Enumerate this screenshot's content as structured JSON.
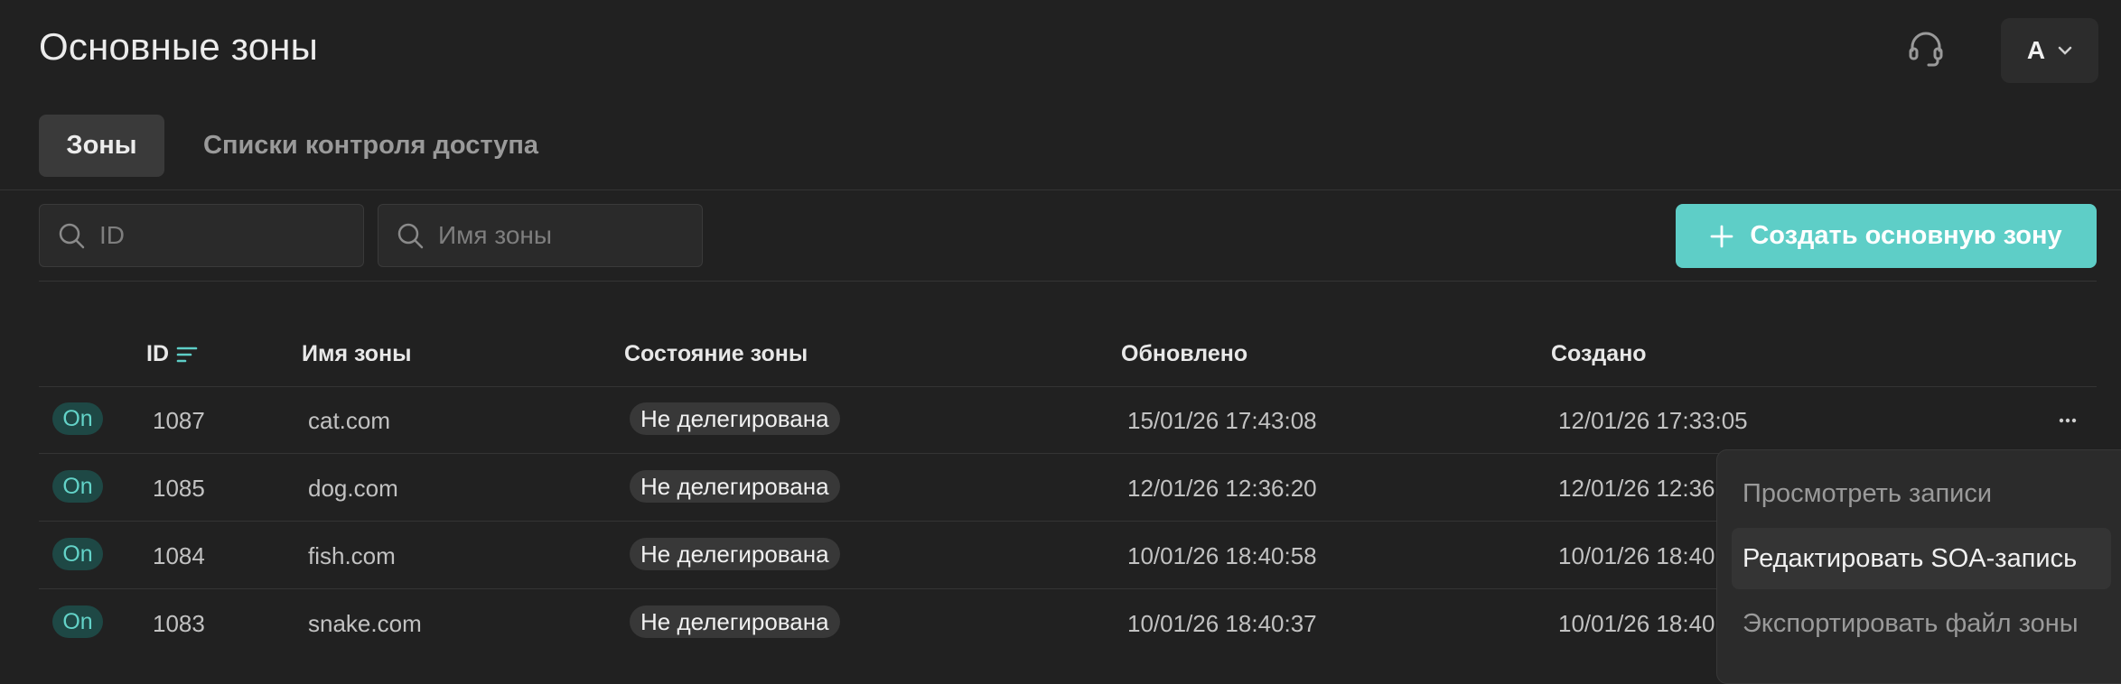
{
  "header": {
    "title": "Основные зоны",
    "user_initial": "A"
  },
  "tabs": [
    {
      "label": "Зоны",
      "active": true
    },
    {
      "label": "Списки контроля доступа",
      "active": false
    }
  ],
  "filters": {
    "id_placeholder": "ID",
    "name_placeholder": "Имя зоны"
  },
  "create_button": {
    "label": "Создать основную зону"
  },
  "table": {
    "columns": [
      "ID",
      "Имя зоны",
      "Состояние зоны",
      "Обновлено",
      "Создано"
    ],
    "rows": [
      {
        "toggle": "On",
        "id": "1087",
        "name": "cat.com",
        "status": "Не делегирована",
        "updated": "15/01/26 17:43:08",
        "created": "12/01/26 17:33:05"
      },
      {
        "toggle": "On",
        "id": "1085",
        "name": "dog.com",
        "status": "Не делегирована",
        "updated": "12/01/26 12:36:20",
        "created": "12/01/26 12:36:"
      },
      {
        "toggle": "On",
        "id": "1084",
        "name": "fish.com",
        "status": "Не делегирована",
        "updated": "10/01/26 18:40:58",
        "created": "10/01/26 18:40:"
      },
      {
        "toggle": "On",
        "id": "1083",
        "name": "snake.com",
        "status": "Не делегирована",
        "updated": "10/01/26 18:40:37",
        "created": "10/01/26 18:40:"
      }
    ]
  },
  "context_menu": {
    "items": [
      "Просмотреть записи",
      "Редактировать SOA-запись",
      "Экспортировать файл зоны"
    ]
  },
  "colors": {
    "background": "#212121",
    "accent": "#5ecec7",
    "on_badge_bg": "#1e4845",
    "on_badge_text": "#63d3c8"
  }
}
